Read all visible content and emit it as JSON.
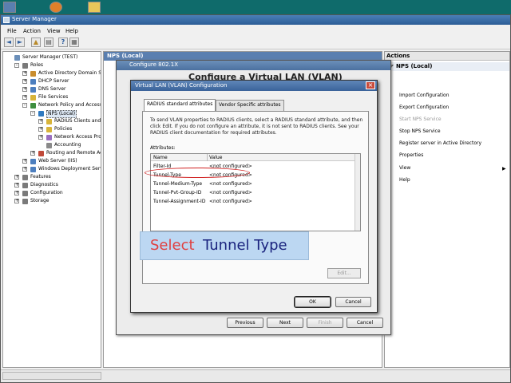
{
  "main_window": {
    "title": "Server Manager",
    "menu": [
      "File",
      "Action",
      "View",
      "Help"
    ]
  },
  "tree": {
    "items": [
      {
        "label": "Server Manager (TEST)",
        "indent": 0,
        "expander": "",
        "selected": false,
        "icon_color": "#6b8fb9"
      },
      {
        "label": "Roles",
        "indent": 1,
        "expander": "-",
        "selected": false,
        "icon_color": "#7a7a7a"
      },
      {
        "label": "Active Directory Domain Se",
        "indent": 2,
        "expander": "+",
        "selected": false,
        "icon_color": "#c98d2e"
      },
      {
        "label": "DHCP Server",
        "indent": 2,
        "expander": "+",
        "selected": false,
        "icon_color": "#4d7fbf"
      },
      {
        "label": "DNS Server",
        "indent": 2,
        "expander": "+",
        "selected": false,
        "icon_color": "#4d7fbf"
      },
      {
        "label": "File Services",
        "indent": 2,
        "expander": "+",
        "selected": false,
        "icon_color": "#d8b43a"
      },
      {
        "label": "Network Policy and Access",
        "indent": 2,
        "expander": "-",
        "selected": false,
        "icon_color": "#3f8e3f"
      },
      {
        "label": "NPS (Local)",
        "indent": 3,
        "expander": "-",
        "selected": true,
        "icon_color": "#2f7ac0"
      },
      {
        "label": "RADIUS Clients and",
        "indent": 4,
        "expander": "+",
        "selected": false,
        "icon_color": "#d8b43a"
      },
      {
        "label": "Policies",
        "indent": 4,
        "expander": "+",
        "selected": false,
        "icon_color": "#d8b43a"
      },
      {
        "label": "Network Access Pro",
        "indent": 4,
        "expander": "+",
        "selected": false,
        "icon_color": "#9a6fc0"
      },
      {
        "label": "Accounting",
        "indent": 4,
        "expander": "",
        "selected": false,
        "icon_color": "#8a8a8a"
      },
      {
        "label": "Routing and Remote Ac",
        "indent": 3,
        "expander": "+",
        "selected": false,
        "icon_color": "#c04a3a"
      },
      {
        "label": "Web Server (IIS)",
        "indent": 2,
        "expander": "+",
        "selected": false,
        "icon_color": "#4d7fbf"
      },
      {
        "label": "Windows Deployment Servi",
        "indent": 2,
        "expander": "+",
        "selected": false,
        "icon_color": "#4d7fbf"
      },
      {
        "label": "Features",
        "indent": 1,
        "expander": "+",
        "selected": false,
        "icon_color": "#7a7a7a"
      },
      {
        "label": "Diagnostics",
        "indent": 1,
        "expander": "+",
        "selected": false,
        "icon_color": "#7a7a7a"
      },
      {
        "label": "Configuration",
        "indent": 1,
        "expander": "+",
        "selected": false,
        "icon_color": "#7a7a7a"
      },
      {
        "label": "Storage",
        "indent": 1,
        "expander": "+",
        "selected": false,
        "icon_color": "#7a7a7a"
      }
    ]
  },
  "center": {
    "header": "NPS (Local)"
  },
  "actions": {
    "header": "Actions",
    "sub_header": "NPS (Local)",
    "items": [
      {
        "label": "Import Configuration",
        "disabled": false
      },
      {
        "label": "Export Configuration",
        "disabled": false
      },
      {
        "label": "Start NPS Service",
        "disabled": true
      },
      {
        "label": "Stop NPS Service",
        "disabled": false
      },
      {
        "label": "Register server in Active Directory",
        "disabled": false
      },
      {
        "label": "Properties",
        "disabled": false
      },
      {
        "label": "View",
        "disabled": false,
        "submenu": true
      },
      {
        "label": "Help",
        "disabled": false
      }
    ]
  },
  "wizard": {
    "title": "Configure 802.1X",
    "heading": "Configure a Virtual LAN (VLAN)",
    "buttons": {
      "previous": "Previous",
      "next": "Next",
      "finish": "Finish",
      "cancel": "Cancel"
    }
  },
  "vlan_dialog": {
    "title": "Virtual LAN (VLAN) Configuration",
    "tabs": [
      "RADIUS standard attributes",
      "Vendor Specific attributes"
    ],
    "instructions": "To send VLAN properties to RADIUS clients, select a RADIUS standard attribute, and then click Edit. If you do not configure an attribute, it is not sent to RADIUS clients. See your RADIUS client documentation for required attributes.",
    "attributes_label": "Attributes:",
    "columns": [
      "Name",
      "Value"
    ],
    "rows": [
      {
        "name": "Filter-Id",
        "value": "<not configured>"
      },
      {
        "name": "Tunnel-Type",
        "value": "<not configured>"
      },
      {
        "name": "Tunnel-Medium-Type",
        "value": "<not configured>"
      },
      {
        "name": "Tunnel-Pvt-Group-ID",
        "value": "<not configured>"
      },
      {
        "name": "Tunnel-Assignment-ID",
        "value": "<not configured>"
      }
    ],
    "edit_button": "Edit...",
    "ok_button": "OK",
    "cancel_button": "Cancel"
  },
  "callout": {
    "word1": "Select",
    "word2": "Tunnel Type",
    "color1": "#e04040",
    "color2": "#1a237e"
  }
}
